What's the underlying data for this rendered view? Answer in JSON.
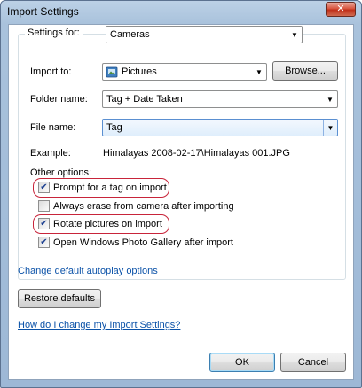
{
  "window": {
    "title": "Import Settings",
    "close_glyph": "✕"
  },
  "settings_for": {
    "label": "Settings for:",
    "value": "Cameras"
  },
  "import_to": {
    "label": "Import to:",
    "value": "Pictures",
    "icon": "pictures-folder-icon",
    "browse": "Browse..."
  },
  "folder_name": {
    "label": "Folder name:",
    "value": "Tag + Date Taken"
  },
  "file_name": {
    "label": "File name:",
    "value": "Tag"
  },
  "example": {
    "label": "Example:",
    "value": "Himalayas 2008-02-17\\Himalayas 001.JPG"
  },
  "other_options": {
    "label": "Other options:",
    "items": [
      {
        "label": "Prompt for a tag on import",
        "checked": true,
        "highlighted": true
      },
      {
        "label": "Always erase from camera after importing",
        "checked": false,
        "highlighted": false
      },
      {
        "label": "Rotate pictures on import",
        "checked": true,
        "highlighted": true
      },
      {
        "label": "Open Windows Photo Gallery after import",
        "checked": true,
        "highlighted": false
      }
    ]
  },
  "links": {
    "autoplay": "Change default autoplay options",
    "help": "How do I change my Import Settings?"
  },
  "buttons": {
    "restore": "Restore defaults",
    "ok": "OK",
    "cancel": "Cancel"
  },
  "colors": {
    "highlight": "#c8243a",
    "link": "#0b52a8",
    "accent": "#3c7fb1"
  }
}
